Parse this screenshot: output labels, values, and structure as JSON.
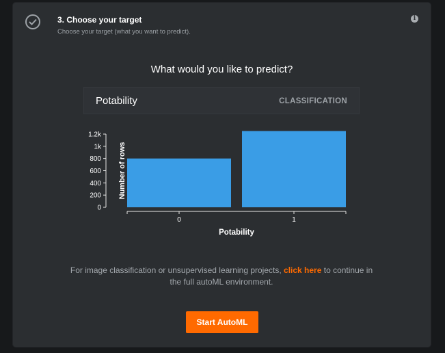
{
  "step": {
    "title": "3. Choose your target",
    "subtitle": "Choose your target (what you want to predict)."
  },
  "icons": {
    "step_status": "check-circle-icon",
    "info": "info-icon"
  },
  "question": "What would you like to predict?",
  "target": {
    "name": "Potability",
    "type": "CLASSIFICATION"
  },
  "helper": {
    "text_before": "For image classification or unsupervised learning projects,",
    "link": "click here",
    "text_after": "to continue in the full autoML environment."
  },
  "start_button": "Start AutoML",
  "colors": {
    "accent": "#ff6a00",
    "bar": "#3a9de6",
    "panel": "#2b2e31"
  },
  "chart_data": {
    "type": "bar",
    "categories": [
      "0",
      "1"
    ],
    "values": [
      800,
      1250
    ],
    "xlabel": "Potability",
    "ylabel": "Number of rows",
    "ylim": [
      0,
      1200
    ],
    "yticks": [
      "0",
      "200",
      "400",
      "600",
      "800",
      "1k",
      "1.2k"
    ],
    "ytick_values": [
      0,
      200,
      400,
      600,
      800,
      1000,
      1200
    ],
    "grid": false
  }
}
